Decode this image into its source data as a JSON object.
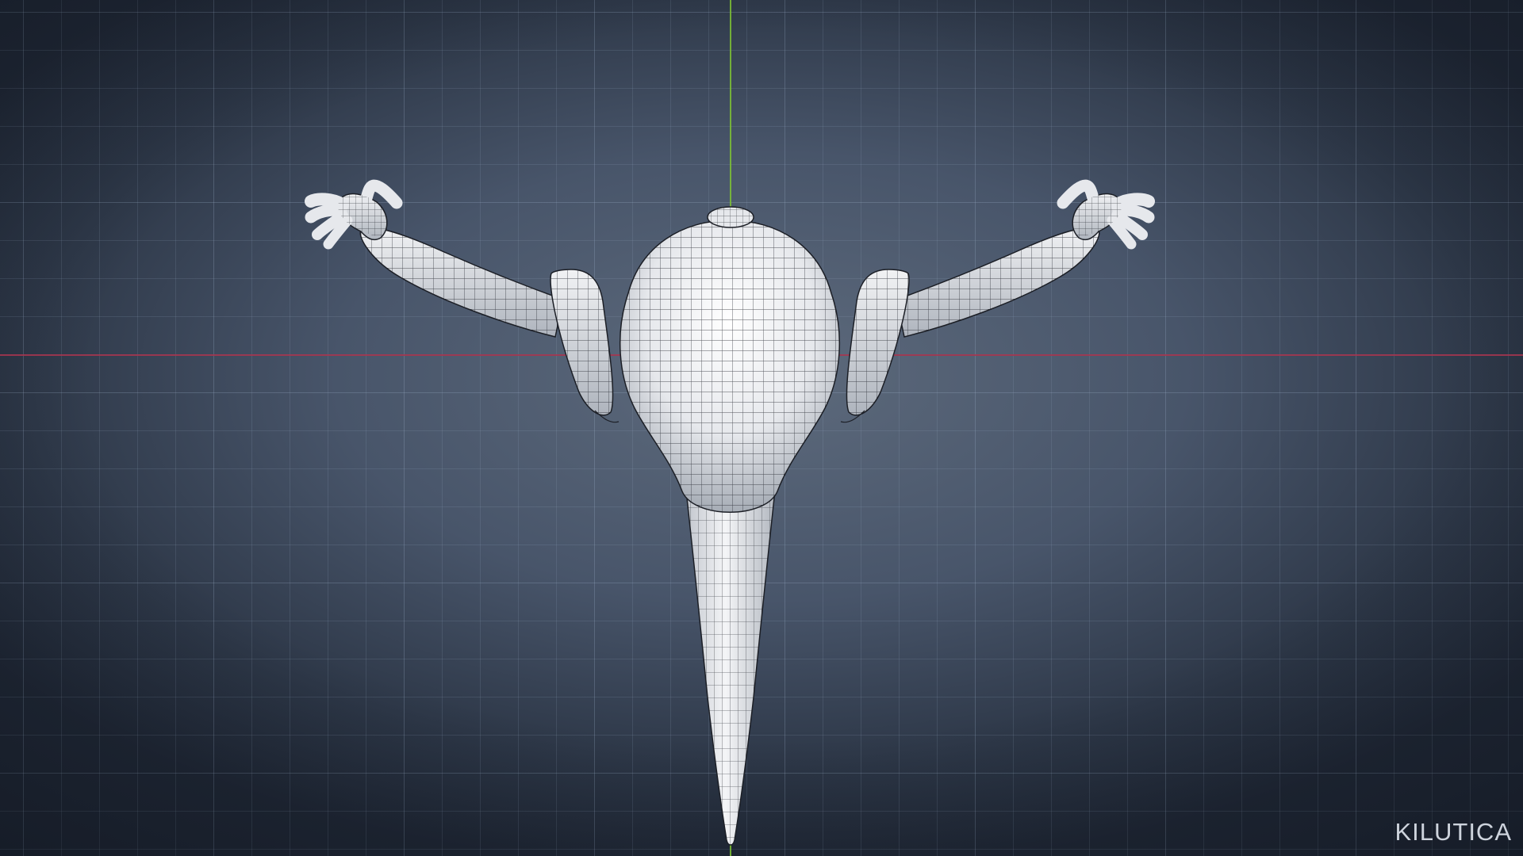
{
  "watermark": {
    "text": "KILUTICA"
  },
  "colors": {
    "background": "#48556a",
    "grid": "#96aac3",
    "x_axis": "#a8344d",
    "y_axis": "#7ec234",
    "mesh_fill": "#e6e8ec",
    "wireframe": "#1c1f26"
  }
}
